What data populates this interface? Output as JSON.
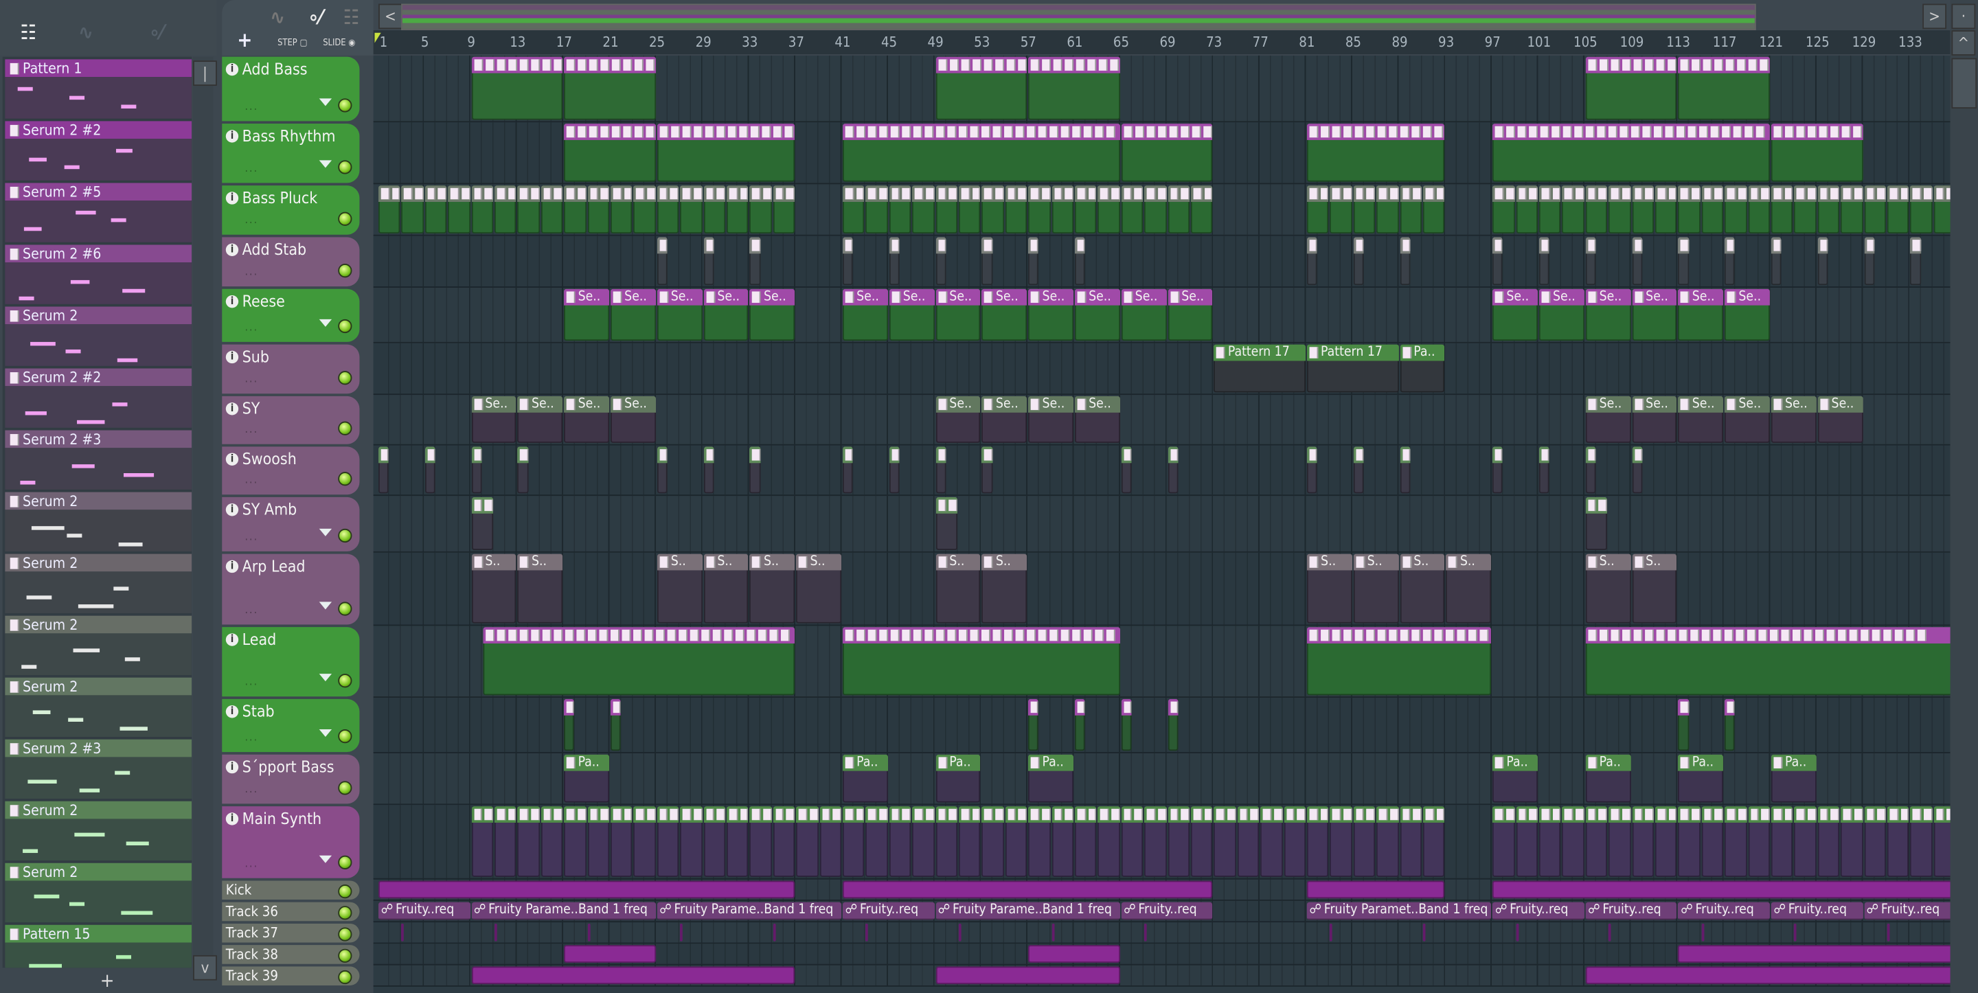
{
  "toolbar": {
    "add_label": "+",
    "step_label": "STEP",
    "slide_label": "SLIDE",
    "left_arrow": "<",
    "right_arrow": ">",
    "up_arrow": "^",
    "down_arrow": "v"
  },
  "picker": {
    "add_label": "+",
    "items": [
      {
        "name": "Pattern 1",
        "head": "#8d3a98",
        "body": "#4a3a55",
        "note": "#f0a0f0"
      },
      {
        "name": "Serum 2 #2",
        "head": "#8d3a98",
        "body": "#4a3a55",
        "note": "#f0a0f0"
      },
      {
        "name": "Serum 2 #5",
        "head": "#8b4494",
        "body": "#4a3a55",
        "note": "#f0a0f0"
      },
      {
        "name": "Serum 2 #6",
        "head": "#874a90",
        "body": "#4a3a55",
        "note": "#f0a0f0"
      },
      {
        "name": "Serum 2",
        "head": "#7f4e86",
        "body": "#473d54",
        "note": "#f0a0f0"
      },
      {
        "name": "Serum 2 #2",
        "head": "#7b5282",
        "body": "#463e52",
        "note": "#f0a0f0"
      },
      {
        "name": "Serum 2 #3",
        "head": "#76587c",
        "body": "#43404e",
        "note": "#f0a0f0"
      },
      {
        "name": "Serum 2",
        "head": "#706274",
        "body": "#41434a",
        "note": "#e8e8e8"
      },
      {
        "name": "Serum 2",
        "head": "#6c666c",
        "body": "#3f454a",
        "note": "#e8e8e8"
      },
      {
        "name": "Serum 2",
        "head": "#676e66",
        "body": "#3e4849",
        "note": "#e8e8e8"
      },
      {
        "name": "Serum 2",
        "head": "#627662",
        "body": "#3d4a48",
        "note": "#d8f0d8"
      },
      {
        "name": "Serum 2 #3",
        "head": "#5e7c5c",
        "body": "#3c4c47",
        "note": "#c8f0c8"
      },
      {
        "name": "Serum 2",
        "head": "#5a8257",
        "body": "#3b4e46",
        "note": "#c0f0c0"
      },
      {
        "name": "Serum 2",
        "head": "#568852",
        "body": "#3a5045",
        "note": "#b8f0b8"
      },
      {
        "name": "Pattern 15",
        "head": "#4f8e4b",
        "body": "#395244",
        "note": "#b0f0b0"
      }
    ]
  },
  "ruler": {
    "labels": [
      "1",
      "5",
      "9",
      "13",
      "17",
      "21",
      "25",
      "29",
      "33",
      "37",
      "41",
      "45",
      "49",
      "53",
      "57",
      "61",
      "65",
      "69",
      "73",
      "77",
      "81",
      "85",
      "89",
      "93",
      "97",
      "101",
      "105",
      "109",
      "113",
      "117",
      "121",
      "125",
      "129",
      "133"
    ]
  },
  "tracks": [
    {
      "name": "Add Bass",
      "color": "#40993a",
      "dropdown": true,
      "clips": [
        {
          "s": 9,
          "l": 8,
          "head": "#a04aa8",
          "body": "#2e6a34"
        },
        {
          "s": 17,
          "l": 8,
          "head": "#a04aa8",
          "body": "#2e6a34"
        },
        {
          "s": 49,
          "l": 8,
          "head": "#a04aa8",
          "body": "#2e6a34"
        },
        {
          "s": 57,
          "l": 8,
          "head": "#a04aa8",
          "body": "#2e6a34"
        },
        {
          "s": 105,
          "l": 8,
          "head": "#a04aa8",
          "body": "#2e6a34"
        },
        {
          "s": 113,
          "l": 8,
          "head": "#a04aa8",
          "body": "#2e6a34"
        }
      ]
    },
    {
      "name": "Bass Rhythm",
      "color": "#40993a",
      "dropdown": true,
      "clips": [
        {
          "s": 17,
          "l": 8,
          "head": "#a04aa8",
          "body": "#2b6a32"
        },
        {
          "s": 25,
          "l": 12,
          "head": "#a04aa8",
          "body": "#2b6a32"
        },
        {
          "s": 41,
          "l": 24,
          "head": "#a04aa8",
          "body": "#2b6a32"
        },
        {
          "s": 65,
          "l": 8,
          "head": "#a04aa8",
          "body": "#2b6a32"
        },
        {
          "s": 81,
          "l": 12,
          "head": "#a04aa8",
          "body": "#2b6a32"
        },
        {
          "s": 97,
          "l": 24,
          "head": "#a04aa8",
          "body": "#2b6a32"
        },
        {
          "s": 121,
          "l": 8,
          "head": "#a04aa8",
          "body": "#2b6a32"
        }
      ]
    },
    {
      "name": "Bass Pluck",
      "color": "#40993a",
      "dropdown": false,
      "repeat": [
        {
          "from": 1,
          "to": 37,
          "each": 2,
          "head": "#6d7a6b",
          "body": "#2b6a32"
        },
        {
          "from": 41,
          "to": 73,
          "each": 2,
          "head": "#6d7a6b",
          "body": "#2b6a32"
        },
        {
          "from": 81,
          "to": 93,
          "each": 2,
          "head": "#6d7a6b",
          "body": "#2b6a32"
        },
        {
          "from": 97,
          "to": 137,
          "each": 2,
          "head": "#6d7a6b",
          "body": "#2b6a32"
        }
      ]
    },
    {
      "name": "Add Stab",
      "color": "#7c5a7c",
      "dropdown": false,
      "repeat": [
        {
          "from": 25,
          "to": 37,
          "each": 4,
          "len": 1,
          "head": "#7a7f7a",
          "body": "#3a4048"
        },
        {
          "from": 41,
          "to": 65,
          "each": 4,
          "len": 1,
          "head": "#7a7f7a",
          "body": "#3a4048"
        },
        {
          "from": 81,
          "to": 93,
          "each": 4,
          "len": 1,
          "head": "#7a7f7a",
          "body": "#3a4048"
        },
        {
          "from": 97,
          "to": 137,
          "each": 4,
          "len": 1,
          "head": "#7a7f7a",
          "body": "#3a4048"
        }
      ]
    },
    {
      "name": "Reese",
      "color": "#40993a",
      "dropdown": true,
      "repeat": [
        {
          "from": 17,
          "to": 37,
          "each": 4,
          "label": "Se..",
          "head": "#a04aa8",
          "body": "#2b6a32"
        },
        {
          "from": 41,
          "to": 73,
          "each": 4,
          "label": "Se..",
          "head": "#a04aa8",
          "body": "#2b6a32"
        },
        {
          "from": 97,
          "to": 121,
          "each": 4,
          "label": "Se..",
          "head": "#a04aa8",
          "body": "#2b6a32"
        }
      ]
    },
    {
      "name": "Sub",
      "color": "#7c5a7c",
      "dropdown": false,
      "clips": [
        {
          "s": 73,
          "l": 8,
          "label": "Pattern 17",
          "head": "#4a8a44",
          "body": "#33373d"
        },
        {
          "s": 81,
          "l": 8,
          "label": "Pattern 17",
          "head": "#4a8a44",
          "body": "#33373d"
        },
        {
          "s": 89,
          "l": 4,
          "label": "Pa..",
          "head": "#4a8a44",
          "body": "#33373d"
        }
      ]
    },
    {
      "name": "SY",
      "color": "#7c5a7c",
      "dropdown": false,
      "repeat": [
        {
          "from": 9,
          "to": 25,
          "each": 4,
          "label": "Se..",
          "head": "#62785f",
          "body": "#3f3548"
        },
        {
          "from": 49,
          "to": 65,
          "each": 4,
          "label": "Se..",
          "head": "#62785f",
          "body": "#3f3548"
        },
        {
          "from": 105,
          "to": 129,
          "each": 4,
          "label": "Se..",
          "head": "#62785f",
          "body": "#3f3548"
        }
      ]
    },
    {
      "name": "Swoosh",
      "color": "#7c5a7c",
      "dropdown": false,
      "starts": [
        1,
        5,
        9,
        13,
        25,
        29,
        33,
        41,
        45,
        49,
        53,
        65,
        69,
        81,
        85,
        89,
        97,
        101,
        105,
        109
      ],
      "slen": 1,
      "shead": "#5f8a5a",
      "sbody": "#3c3a48"
    },
    {
      "name": "SY Amb",
      "color": "#7c5a7c",
      "dropdown": true,
      "starts": [
        9,
        49,
        105
      ],
      "slen": 2,
      "shead": "#5f8a5a",
      "sbody": "#3c3a48"
    },
    {
      "name": "Arp Lead",
      "color": "#7c5a7c",
      "dropdown": true,
      "starts": [
        9,
        13,
        25,
        29,
        33,
        37,
        49,
        53,
        81,
        85,
        89,
        93,
        105,
        109
      ],
      "slen": 4,
      "slabel": "S..",
      "shead": "#7a7078",
      "sbody": "#3e3848"
    },
    {
      "name": "Lead",
      "color": "#40993a",
      "dropdown": true,
      "clips": [
        {
          "s": 10,
          "l": 27,
          "head": "#a04aa8",
          "body": "#2b6a32"
        },
        {
          "s": 41,
          "l": 24,
          "head": "#a04aa8",
          "body": "#2b6a32"
        },
        {
          "s": 81,
          "l": 16,
          "head": "#a04aa8",
          "body": "#2b6a32"
        },
        {
          "s": 105,
          "l": 32,
          "head": "#a04aa8",
          "body": "#2b6a32"
        }
      ]
    },
    {
      "name": "Stab",
      "color": "#40993a",
      "dropdown": true,
      "starts": [
        17,
        21,
        57,
        61,
        65,
        69,
        113,
        117
      ],
      "slen": 1,
      "shead": "#a04aa8",
      "sbody": "#2b5a32"
    },
    {
      "name": "S´pport Bass",
      "color": "#7c5a7c",
      "dropdown": false,
      "starts": [
        17,
        41,
        49,
        57,
        97,
        105,
        113,
        121
      ],
      "slen": 4,
      "slabel": "Pa..",
      "shead": "#4f8a48",
      "sbody": "#3e3450"
    },
    {
      "name": "Main Synth",
      "color": "#8a4c8a",
      "dropdown": true,
      "repeat": [
        {
          "from": 9,
          "to": 93,
          "each": 2,
          "head": "#4f8a48",
          "body": "#43355a"
        },
        {
          "from": 97,
          "to": 137,
          "each": 2,
          "head": "#4f8a48",
          "body": "#43355a"
        }
      ]
    },
    {
      "name": "Kick",
      "color": "#6a7067",
      "small": true,
      "clips": [
        {
          "s": 1,
          "l": 36,
          "head": "#8a2a94",
          "body": "#8a2a94"
        },
        {
          "s": 41,
          "l": 32,
          "head": "#8a2a94",
          "body": "#8a2a94"
        },
        {
          "s": 81,
          "l": 12,
          "head": "#8a2a94",
          "body": "#8a2a94"
        },
        {
          "s": 97,
          "l": 40,
          "head": "#8a2a94",
          "body": "#8a2a94"
        }
      ]
    },
    {
      "name": "Track 36",
      "color": "#6a7067",
      "small": true,
      "clips": [
        {
          "s": 1,
          "l": 8,
          "label": "Fruity..req",
          "head": "#6f3f78",
          "body": "#6f3f78",
          "auto": true
        },
        {
          "s": 9,
          "l": 16,
          "label": "Fruity Parame..Band 1 freq",
          "head": "#6f3f78",
          "body": "#6f3f78",
          "auto": true
        },
        {
          "s": 25,
          "l": 16,
          "label": "Fruity Parame..Band 1 freq",
          "head": "#6f3f78",
          "body": "#6f3f78",
          "auto": true
        },
        {
          "s": 41,
          "l": 8,
          "label": "Fruity..req",
          "head": "#6f3f78",
          "body": "#6f3f78",
          "auto": true
        },
        {
          "s": 49,
          "l": 16,
          "label": "Fruity Parame..Band 1 freq",
          "head": "#6f3f78",
          "body": "#6f3f78",
          "auto": true
        },
        {
          "s": 65,
          "l": 8,
          "label": "Fruity..req",
          "head": "#6f3f78",
          "body": "#6f3f78",
          "auto": true
        },
        {
          "s": 81,
          "l": 16,
          "label": "Fruity Paramet..Band 1 freq",
          "head": "#6f3f78",
          "body": "#6f3f78",
          "auto": true
        },
        {
          "s": 97,
          "l": 8,
          "label": "Fruity..req",
          "head": "#6f3f78",
          "body": "#6f3f78",
          "auto": true
        },
        {
          "s": 105,
          "l": 8,
          "label": "Fruity..req",
          "head": "#6f3f78",
          "body": "#6f3f78",
          "auto": true
        },
        {
          "s": 113,
          "l": 8,
          "label": "Fruity..req",
          "head": "#6f3f78",
          "body": "#6f3f78",
          "auto": true
        },
        {
          "s": 121,
          "l": 8,
          "label": "Fruity..req",
          "head": "#6f3f78",
          "body": "#6f3f78",
          "auto": true
        },
        {
          "s": 129,
          "l": 8,
          "label": "Fruity..req",
          "head": "#6f3f78",
          "body": "#6f3f78",
          "auto": true
        }
      ]
    },
    {
      "name": "Track 37",
      "color": "#6a7067",
      "small": true,
      "starts": [
        3,
        11,
        19,
        27,
        35,
        43,
        51,
        59,
        67,
        83,
        91,
        99,
        107,
        115,
        123,
        131
      ],
      "slen": 0.3,
      "shead": "#9a2aa4",
      "sbody": "#9a2aa4"
    },
    {
      "name": "Track 38",
      "color": "#6a7067",
      "small": true,
      "clips": [
        {
          "s": 17,
          "l": 8,
          "head": "#8a2a94",
          "body": "#8a2a94"
        },
        {
          "s": 57,
          "l": 8,
          "head": "#8a2a94",
          "body": "#8a2a94"
        },
        {
          "s": 113,
          "l": 24,
          "head": "#8a2a94",
          "body": "#8a2a94"
        }
      ]
    },
    {
      "name": "Track 39",
      "color": "#6a7067",
      "small": true,
      "clips": [
        {
          "s": 9,
          "l": 28,
          "head": "#8a2a94",
          "body": "#8a2a94"
        },
        {
          "s": 49,
          "l": 16,
          "head": "#8a2a94",
          "body": "#8a2a94"
        },
        {
          "s": 105,
          "l": 32,
          "head": "#8a2a94",
          "body": "#8a2a94"
        }
      ]
    }
  ]
}
